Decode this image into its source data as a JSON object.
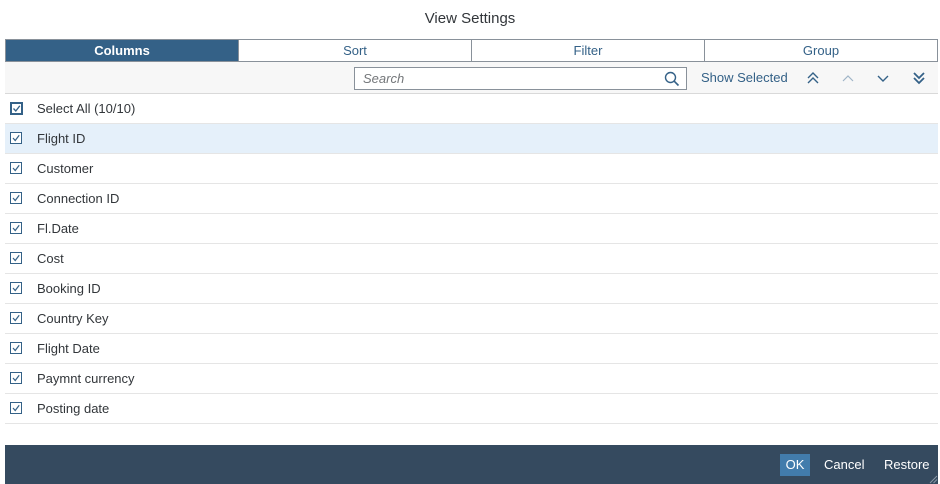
{
  "dialog": {
    "title": "View Settings"
  },
  "tabs": [
    {
      "label": "Columns",
      "active": true
    },
    {
      "label": "Sort",
      "active": false
    },
    {
      "label": "Filter",
      "active": false
    },
    {
      "label": "Group",
      "active": false
    }
  ],
  "toolbar": {
    "search_placeholder": "Search",
    "show_selected_label": "Show Selected",
    "icons": [
      "move-to-top-icon",
      "move-up-icon",
      "move-down-icon",
      "move-to-bottom-icon"
    ]
  },
  "select_all": {
    "label": "Select All (10/10)",
    "checked": true
  },
  "columns": [
    {
      "label": "Flight ID",
      "checked": true,
      "selected": true
    },
    {
      "label": "Customer",
      "checked": true
    },
    {
      "label": "Connection ID",
      "checked": true
    },
    {
      "label": "Fl.Date",
      "checked": true
    },
    {
      "label": "Cost",
      "checked": true
    },
    {
      "label": "Booking ID",
      "checked": true
    },
    {
      "label": "Country Key",
      "checked": true
    },
    {
      "label": "Flight Date",
      "checked": true
    },
    {
      "label": "Paymnt currency",
      "checked": true
    },
    {
      "label": "Posting date",
      "checked": true
    }
  ],
  "footer": {
    "ok_label": "OK",
    "cancel_label": "Cancel",
    "restore_label": "Restore"
  },
  "colors": {
    "accent": "#346187",
    "footer_bg": "#354a5f",
    "ok_bg": "#427cac",
    "row_selected": "#e5f0fa"
  }
}
